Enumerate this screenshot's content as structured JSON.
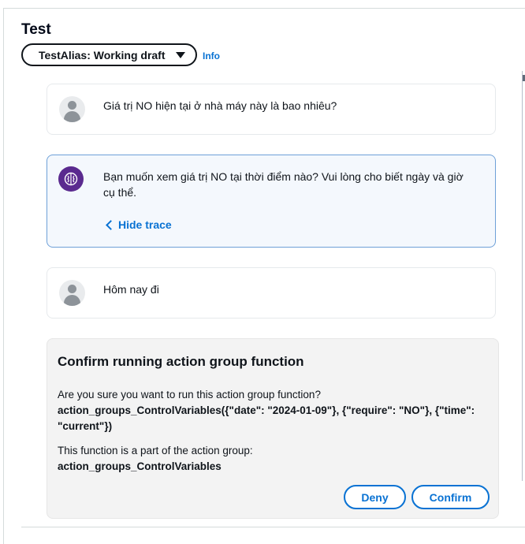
{
  "panel": {
    "title": "Test",
    "alias_select": "TestAlias: Working draft",
    "info_link": "Info"
  },
  "chat": {
    "messages": [
      {
        "role": "user",
        "text": "Giá trị NO hiện tại ở nhà máy này là bao nhiêu?"
      },
      {
        "role": "agent",
        "text": "Bạn muốn xem giá trị NO tại thời điểm nào? Vui lòng cho biết ngày và giờ cụ thể.",
        "trace_link": "Hide trace"
      },
      {
        "role": "user",
        "text": "Hôm nay đi"
      }
    ]
  },
  "confirm": {
    "title": "Confirm running action group function",
    "question": "Are you sure you want to run this action group function?",
    "function_call": "action_groups_ControlVariables({\"date\": \"2024-01-09\"}, {\"require\": \"NO\"}, {\"time\": \"current\"})",
    "part_of_text": "This function is a part of the action group:",
    "group_name": "action_groups_ControlVariables",
    "deny_label": "Deny",
    "confirm_label": "Confirm"
  },
  "colors": {
    "accent": "#0972d3",
    "agent_avatar": "#5a2a8f",
    "confirm_bg": "#f3f3f3"
  }
}
